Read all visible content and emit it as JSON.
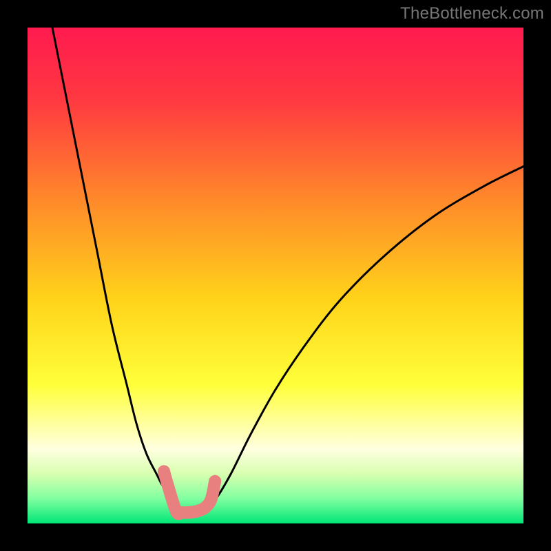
{
  "watermark": "TheBottleneck.com",
  "chart_data": {
    "type": "line",
    "title": "",
    "xlabel": "",
    "ylabel": "",
    "xlim": [
      0,
      100
    ],
    "ylim": [
      0,
      100
    ],
    "background": {
      "type": "vertical_gradient",
      "stops": [
        {
          "offset": 0.0,
          "color": "#ff1a4f"
        },
        {
          "offset": 0.15,
          "color": "#ff3a40"
        },
        {
          "offset": 0.35,
          "color": "#ff8a2a"
        },
        {
          "offset": 0.55,
          "color": "#ffd41a"
        },
        {
          "offset": 0.72,
          "color": "#ffff3a"
        },
        {
          "offset": 0.8,
          "color": "#ffffa0"
        },
        {
          "offset": 0.85,
          "color": "#ffffe0"
        },
        {
          "offset": 0.9,
          "color": "#d8ffb0"
        },
        {
          "offset": 0.95,
          "color": "#80ffa0"
        },
        {
          "offset": 1.0,
          "color": "#00e676"
        }
      ]
    },
    "series": [
      {
        "name": "left_curve",
        "color": "#000000",
        "x": [
          5,
          8,
          11,
          14,
          17,
          20,
          22,
          24,
          26,
          27,
          28,
          29,
          30,
          30.5,
          31
        ],
        "y": [
          100,
          85,
          70,
          55,
          40,
          28,
          20,
          14,
          10,
          8,
          6.5,
          5,
          4,
          3.5,
          3
        ]
      },
      {
        "name": "right_curve",
        "color": "#000000",
        "x": [
          36,
          38,
          41,
          45,
          50,
          56,
          63,
          72,
          82,
          92,
          100
        ],
        "y": [
          3,
          5,
          10,
          18,
          27,
          36,
          45,
          54,
          62,
          68,
          72
        ]
      },
      {
        "name": "floor",
        "color": "#000000",
        "x": [
          31,
          32,
          33,
          34,
          35,
          36
        ],
        "y": [
          3,
          2.5,
          2.2,
          2.2,
          2.5,
          3
        ]
      }
    ],
    "markers": {
      "name": "bottleneck_points",
      "color": "#e98080",
      "radius": 9,
      "points": [
        {
          "x": 27.5,
          "y": 10.5
        },
        {
          "x": 28.2,
          "y": 8.0
        },
        {
          "x": 30.0,
          "y": 2.4
        },
        {
          "x": 31.0,
          "y": 2.2
        },
        {
          "x": 32.2,
          "y": 2.2
        },
        {
          "x": 33.4,
          "y": 2.3
        },
        {
          "x": 34.6,
          "y": 2.6
        },
        {
          "x": 35.8,
          "y": 3.2
        },
        {
          "x": 37.0,
          "y": 4.8
        },
        {
          "x": 37.8,
          "y": 8.5
        }
      ]
    }
  }
}
